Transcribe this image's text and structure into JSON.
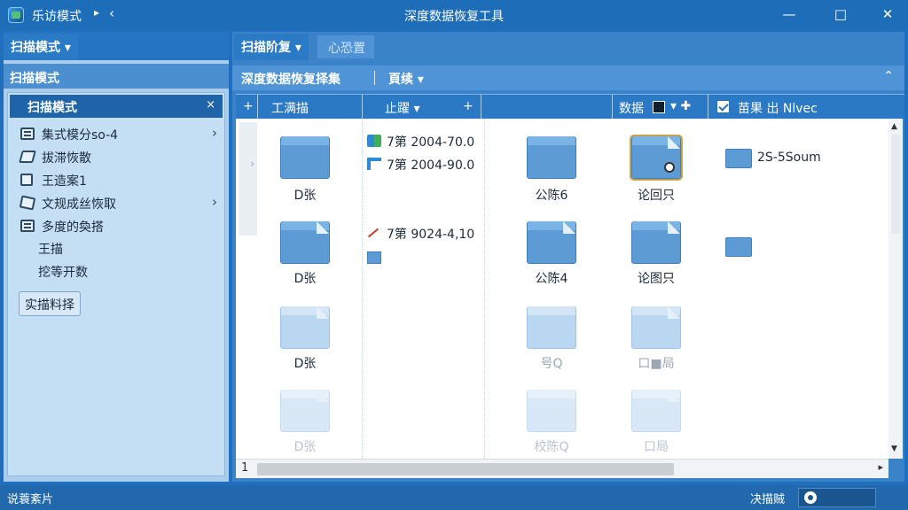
{
  "titlebar": {
    "app_name": "乐访模式",
    "caret": "▸",
    "back": "‹",
    "title": "深度数据恢复工具",
    "minimize": "—",
    "maximize": "□",
    "close": "✕"
  },
  "left": {
    "tab": "扫描模式 ▾",
    "header": "扫描模式",
    "selected": "扫描模式",
    "selected_close": "×",
    "items": [
      {
        "label": "集式模分so-4",
        "icon": "grid-icon",
        "arrow": "›"
      },
      {
        "label": "拔滞恢散",
        "icon": "diamond-icon",
        "arrow": ""
      },
      {
        "label": "王造案1",
        "icon": "document-icon",
        "arrow": ""
      },
      {
        "label": "文规成丝恢取",
        "icon": "gem-icon",
        "arrow": "›"
      },
      {
        "label": "多度的奐搭",
        "icon": "screen-icon",
        "arrow": ""
      }
    ],
    "sub_items": [
      "王描",
      "挖等开数"
    ],
    "scan_button": "实描料择"
  },
  "right": {
    "tab_active": "扫描阶复 ▾",
    "tab_inactive": "心恐置",
    "toolbar_label": "深度数据恢复择集",
    "toolbar_button": "頁续 ▾",
    "toolbar_up": "⌃",
    "columns": {
      "add1": "+",
      "col1": "工满描",
      "col2": "止躍 ▾",
      "add2": "+",
      "col3": "数据",
      "col3_extra": "▾ ✚",
      "col4": "苗果 出 Nlvec"
    },
    "folders": [
      {
        "label": "D张"
      },
      {
        "label": "D张"
      },
      {
        "label": "D张"
      },
      {
        "label": "D张"
      },
      {
        "label": "公陈6"
      },
      {
        "label": "公陈4"
      },
      {
        "label": "号Q"
      },
      {
        "label": "校陈Q"
      },
      {
        "label": "论回只"
      },
      {
        "label": "论图只"
      },
      {
        "label": "口■局"
      },
      {
        "label": "口局"
      }
    ],
    "list_rows": [
      {
        "text": "7第 2004-70.0"
      },
      {
        "text": "7第 2004-90.0"
      },
      {
        "text": "7第 9024-4,10"
      }
    ],
    "side_row": "2S-5Soum",
    "hscroll_num": "1",
    "hscroll_right": "▸",
    "vs_up": "▲",
    "vs_down": "▼"
  },
  "status": {
    "text": "说蓑紊片",
    "label": "决描贼"
  }
}
